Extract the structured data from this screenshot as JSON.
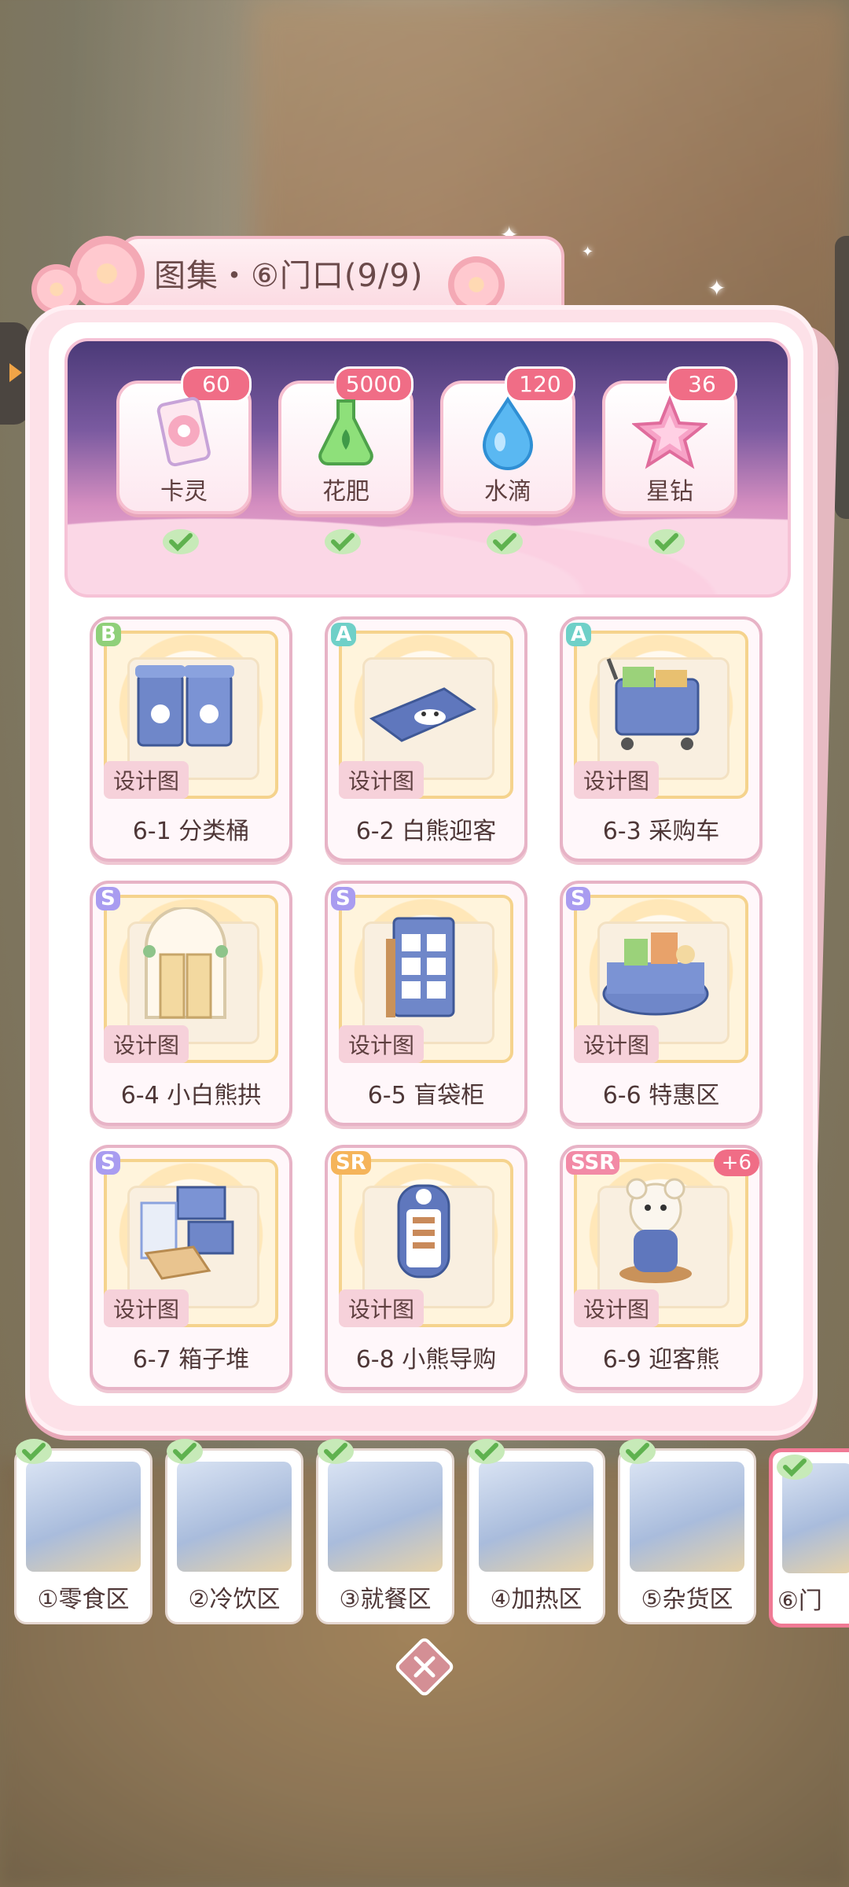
{
  "header": {
    "title": "图集・⑥门口(9/9)"
  },
  "rewards": [
    {
      "label": "卡灵",
      "count": "60",
      "icon": "card-icon"
    },
    {
      "label": "花肥",
      "count": "5000",
      "icon": "fertilizer-flask-icon"
    },
    {
      "label": "水滴",
      "count": "120",
      "icon": "water-drop-icon"
    },
    {
      "label": "星钻",
      "count": "36",
      "icon": "star-diamond-icon"
    }
  ],
  "design_tag": "设计图",
  "items": [
    {
      "rarity": "B",
      "label": "6-1 分类桶",
      "rarity_color": "#8fd07a"
    },
    {
      "rarity": "A",
      "label": "6-2 白熊迎客",
      "rarity_color": "#6fd0c8"
    },
    {
      "rarity": "A",
      "label": "6-3 采购车",
      "rarity_color": "#6fd0c8"
    },
    {
      "rarity": "S",
      "label": "6-4 小白熊拱",
      "rarity_color": "#a99cf0"
    },
    {
      "rarity": "S",
      "label": "6-5 盲袋柜",
      "rarity_color": "#a99cf0"
    },
    {
      "rarity": "S",
      "label": "6-6 特惠区",
      "rarity_color": "#a99cf0"
    },
    {
      "rarity": "S",
      "label": "6-7 箱子堆",
      "rarity_color": "#a99cf0"
    },
    {
      "rarity": "SR",
      "label": "6-8 小熊导购",
      "rarity_color": "#f5b45a"
    },
    {
      "rarity": "SSR",
      "label": "6-9 迎客熊",
      "rarity_color": "#f28aa6",
      "extra": "+6"
    }
  ],
  "areas": [
    {
      "label": "①零食区",
      "completed": true
    },
    {
      "label": "②冷饮区",
      "completed": true
    },
    {
      "label": "③就餐区",
      "completed": true
    },
    {
      "label": "④加热区",
      "completed": true
    },
    {
      "label": "⑤杂货区",
      "completed": true
    },
    {
      "label": "⑥门",
      "completed": true,
      "active": true
    }
  ],
  "colors": {
    "accent_pink": "#f06d86",
    "check_green": "#7cc96a",
    "panel_pink": "#fde1e8"
  }
}
